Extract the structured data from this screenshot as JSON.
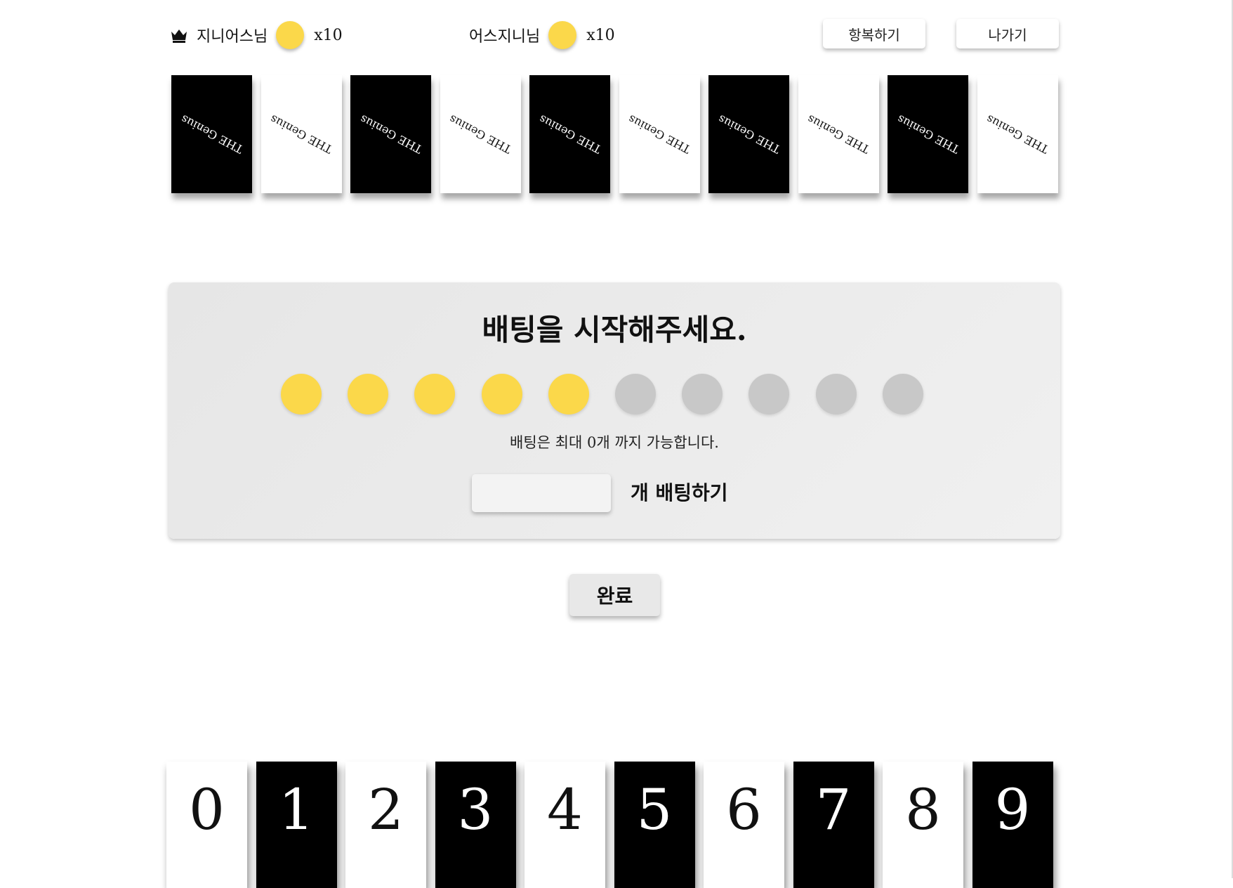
{
  "header": {
    "player1": {
      "name": "지니어스님",
      "coins": "x10",
      "icon": "crown-icon"
    },
    "player2": {
      "name": "어스지니님",
      "coins": "x10"
    },
    "surrender_label": "항복하기",
    "leave_label": "나가기"
  },
  "opponent_cards": [
    {
      "color": "black",
      "logo": "THE Genius"
    },
    {
      "color": "white",
      "logo": "THE Genius"
    },
    {
      "color": "black",
      "logo": "THE Genius"
    },
    {
      "color": "white",
      "logo": "THE Genius"
    },
    {
      "color": "black",
      "logo": "THE Genius"
    },
    {
      "color": "white",
      "logo": "THE Genius"
    },
    {
      "color": "black",
      "logo": "THE Genius"
    },
    {
      "color": "white",
      "logo": "THE Genius"
    },
    {
      "color": "black",
      "logo": "THE Genius"
    },
    {
      "color": "white",
      "logo": "THE Genius"
    }
  ],
  "betting": {
    "title": "배팅을 시작해주세요.",
    "coins_total": 10,
    "coins_active": 5,
    "info": "배팅은 최대 0개 까지 가능합니다.",
    "input_value": "",
    "bet_label": "개 배팅하기"
  },
  "done_label": "완료",
  "hand": [
    {
      "number": "0",
      "color": "white"
    },
    {
      "number": "1",
      "color": "black"
    },
    {
      "number": "2",
      "color": "white"
    },
    {
      "number": "3",
      "color": "black"
    },
    {
      "number": "4",
      "color": "white"
    },
    {
      "number": "5",
      "color": "black"
    },
    {
      "number": "6",
      "color": "white"
    },
    {
      "number": "7",
      "color": "black"
    },
    {
      "number": "8",
      "color": "white"
    },
    {
      "number": "9",
      "color": "black"
    }
  ],
  "colors": {
    "coin": "#fbd84a",
    "coin_inactive": "#c8c8c8",
    "panel": "#ececec"
  }
}
